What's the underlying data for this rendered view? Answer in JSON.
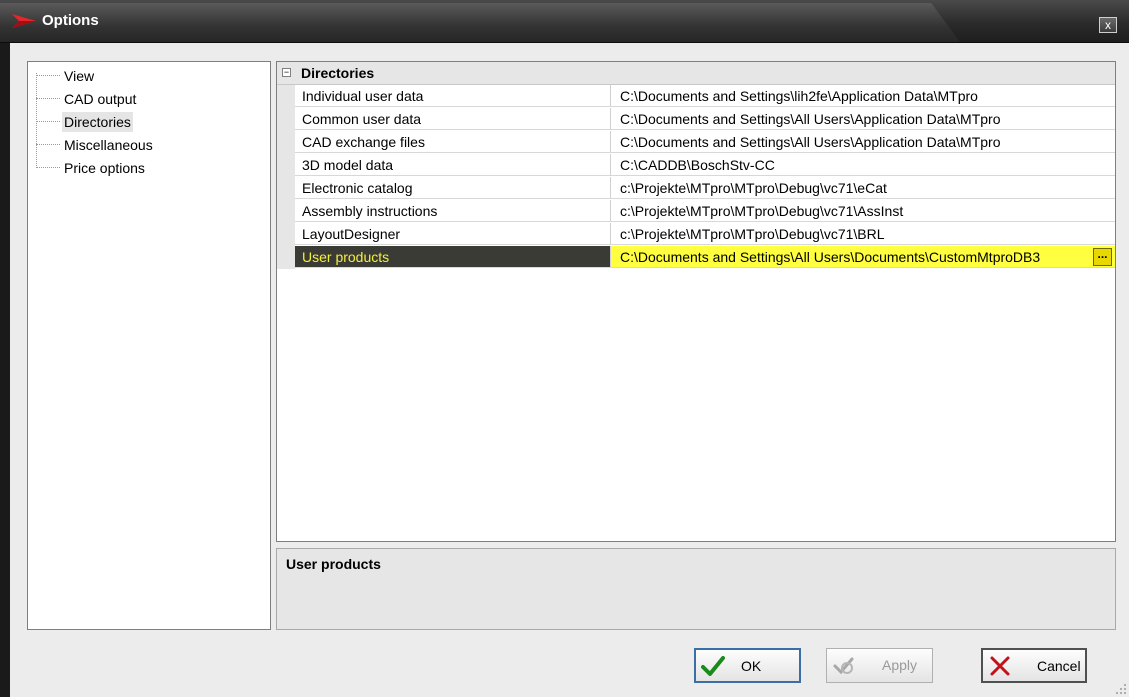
{
  "window": {
    "title": "Options",
    "close_label": "x"
  },
  "tree": {
    "items": [
      {
        "label": "View",
        "selected": false
      },
      {
        "label": "CAD output",
        "selected": false
      },
      {
        "label": "Directories",
        "selected": true
      },
      {
        "label": "Miscellaneous",
        "selected": false
      },
      {
        "label": "Price options",
        "selected": false
      }
    ]
  },
  "grid": {
    "category": {
      "label": "Directories",
      "expander": "−"
    },
    "rows": [
      {
        "name": "Individual user data",
        "value": "C:\\Documents and Settings\\lih2fe\\Application Data\\MTpro"
      },
      {
        "name": "Common user data",
        "value": "C:\\Documents and Settings\\All Users\\Application Data\\MTpro"
      },
      {
        "name": "CAD exchange files",
        "value": "C:\\Documents and Settings\\All Users\\Application Data\\MTpro"
      },
      {
        "name": "3D model data",
        "value": "C:\\CADDB\\BoschStv-CC"
      },
      {
        "name": "Electronic catalog",
        "value": "c:\\Projekte\\MTpro\\MTpro\\Debug\\vc71\\eCat"
      },
      {
        "name": "Assembly instructions",
        "value": "c:\\Projekte\\MTpro\\MTpro\\Debug\\vc71\\AssInst"
      },
      {
        "name": "LayoutDesigner",
        "value": "c:\\Projekte\\MTpro\\MTpro\\Debug\\vc71\\BRL"
      },
      {
        "name": "User products",
        "value": "C:\\Documents and Settings\\All Users\\Documents\\CustomMtproDB3"
      }
    ],
    "browse_label": "..."
  },
  "description": {
    "title": "User products"
  },
  "buttons": {
    "ok": "OK",
    "apply": "Apply",
    "cancel": "Cancel"
  },
  "colors": {
    "selected_name_bg": "#3b3b36",
    "selected_name_fg": "#f4ef3a",
    "selected_value_bg": "#ffff3f"
  }
}
